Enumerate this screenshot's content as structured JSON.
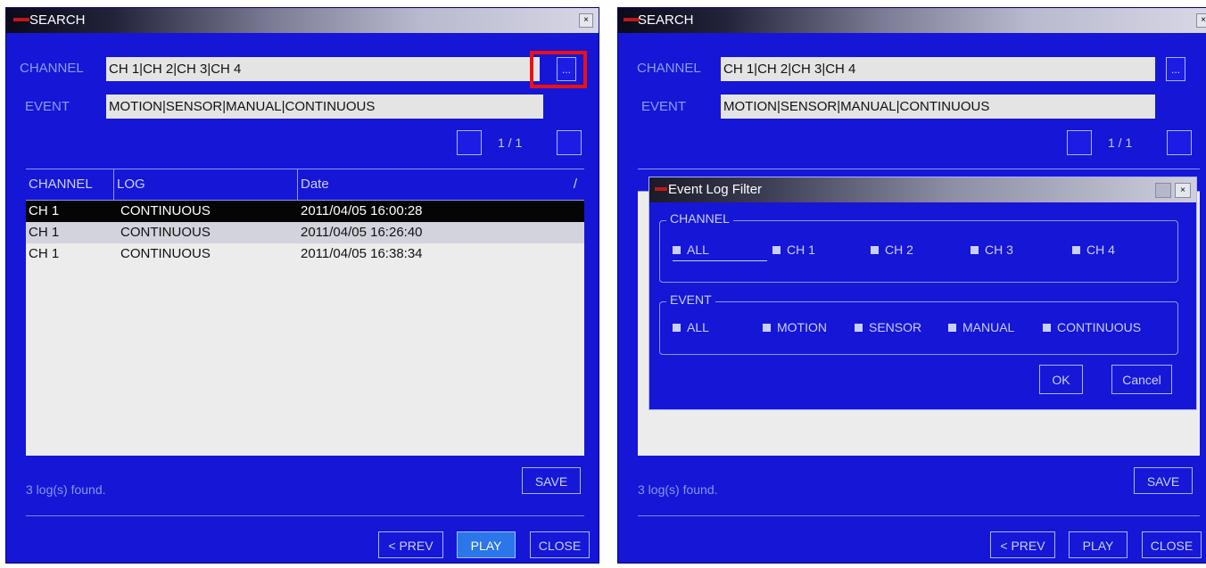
{
  "left_window": {
    "title": "SEARCH",
    "close_glyph": "×",
    "channel_label": "CHANNEL",
    "channel_value": "CH 1|CH 2|CH 3|CH 4",
    "event_label": "EVENT",
    "event_value": "MOTION|SENSOR|MANUAL|CONTINUOUS",
    "dots_label": "...",
    "page_indicator": "1 / 1",
    "table": {
      "headers": [
        "CHANNEL",
        "LOG",
        "Date"
      ],
      "sort_glyph": "/",
      "rows": [
        {
          "channel": "CH 1",
          "log": "CONTINUOUS",
          "date": "2011/04/05 16:00:28"
        },
        {
          "channel": "CH 1",
          "log": "CONTINUOUS",
          "date": "2011/04/05 16:26:40"
        },
        {
          "channel": "CH 1",
          "log": "CONTINUOUS",
          "date": "2011/04/05 16:38:34"
        }
      ]
    },
    "status": "3 log(s) found.",
    "save_label": "SAVE",
    "prev_label": "< PREV",
    "play_label": "PLAY",
    "close_label": "CLOSE"
  },
  "right_window": {
    "title": "SEARCH",
    "close_glyph": "×",
    "channel_label": "CHANNEL",
    "channel_value": "CH 1|CH 2|CH 3|CH 4",
    "event_label": "EVENT",
    "event_value": "MOTION|SENSOR|MANUAL|CONTINUOUS",
    "dots_label": "...",
    "page_indicator": "1 / 1",
    "status": "3 log(s) found.",
    "save_label": "SAVE",
    "prev_label": "< PREV",
    "play_label": "PLAY",
    "close_label": "CLOSE",
    "dialog": {
      "title": "Event Log Filter",
      "close_glyph": "×",
      "channel_group": "CHANNEL",
      "channel_options": [
        {
          "label": "ALL",
          "checked": true
        },
        {
          "label": "CH 1",
          "checked": true
        },
        {
          "label": "CH 2",
          "checked": true
        },
        {
          "label": "CH 3",
          "checked": true
        },
        {
          "label": "CH 4",
          "checked": true
        }
      ],
      "event_group": "EVENT",
      "event_options": [
        {
          "label": "ALL",
          "checked": true
        },
        {
          "label": "MOTION",
          "checked": true
        },
        {
          "label": "SENSOR",
          "checked": true
        },
        {
          "label": "MANUAL",
          "checked": true
        },
        {
          "label": "CONTINUOUS",
          "checked": true
        }
      ],
      "ok_label": "OK",
      "cancel_label": "Cancel"
    }
  },
  "colors": {
    "window_bg": "#1616d6",
    "highlight": "#ee1010",
    "play_active": "#2a76ea"
  }
}
